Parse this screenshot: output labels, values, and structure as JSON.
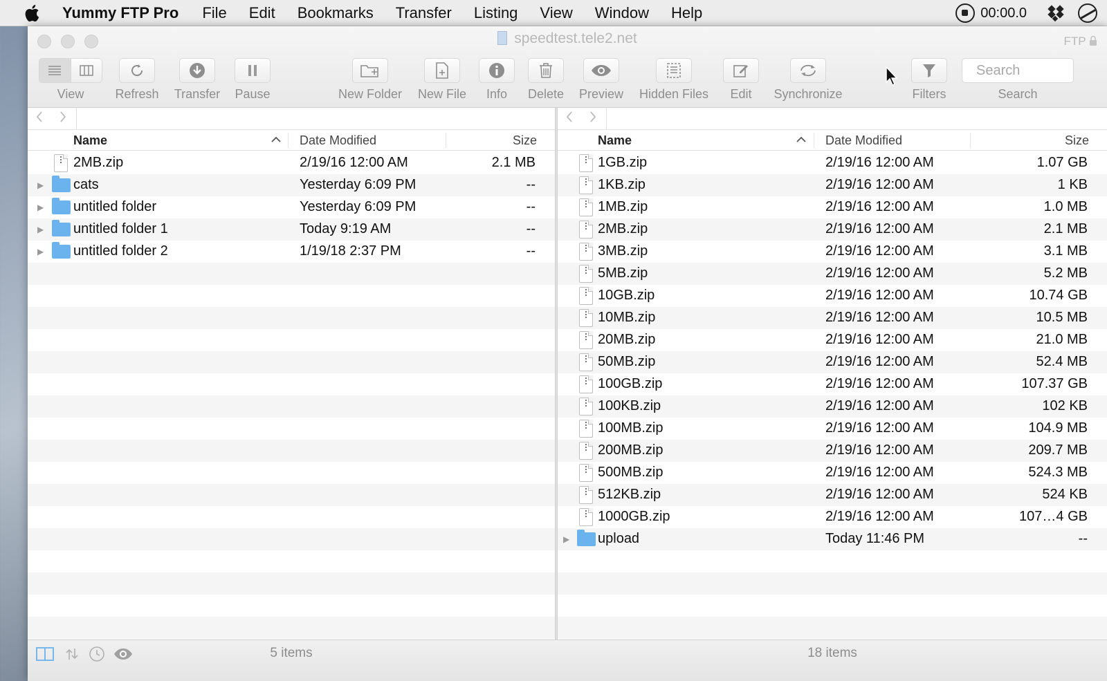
{
  "menubar": {
    "app_name": "Yummy FTP Pro",
    "items": [
      "File",
      "Edit",
      "Bookmarks",
      "Transfer",
      "Listing",
      "View",
      "Window",
      "Help"
    ],
    "recording_time": "00:00.0"
  },
  "window": {
    "title": "speedtest.tele2.net",
    "protocol": "FTP"
  },
  "toolbar": {
    "view": "View",
    "refresh": "Refresh",
    "transfer": "Transfer",
    "pause": "Pause",
    "new_folder": "New Folder",
    "new_file": "New File",
    "info": "Info",
    "delete": "Delete",
    "preview": "Preview",
    "hidden_files": "Hidden Files",
    "edit": "Edit",
    "synchronize": "Synchronize",
    "filters": "Filters",
    "search_placeholder": "Search",
    "search_label": "Search"
  },
  "columns": {
    "name": "Name",
    "date_modified": "Date Modified",
    "size": "Size"
  },
  "left_pane": {
    "status": "5 items",
    "rows": [
      {
        "type": "file",
        "name": "2MB.zip",
        "date": "2/19/16 12:00 AM",
        "size": "2.1 MB"
      },
      {
        "type": "folder",
        "name": "cats",
        "date": "Yesterday 6:09 PM",
        "size": "--"
      },
      {
        "type": "folder",
        "name": "untitled folder",
        "date": "Yesterday 6:09 PM",
        "size": "--"
      },
      {
        "type": "folder",
        "name": "untitled folder 1",
        "date": "Today 9:19 AM",
        "size": "--"
      },
      {
        "type": "folder",
        "name": "untitled folder 2",
        "date": "1/19/18 2:37 PM",
        "size": "--"
      }
    ]
  },
  "right_pane": {
    "status": "18 items",
    "rows": [
      {
        "type": "file",
        "name": "1GB.zip",
        "date": "2/19/16 12:00 AM",
        "size": "1.07 GB"
      },
      {
        "type": "file",
        "name": "1KB.zip",
        "date": "2/19/16 12:00 AM",
        "size": "1 KB"
      },
      {
        "type": "file",
        "name": "1MB.zip",
        "date": "2/19/16 12:00 AM",
        "size": "1.0 MB"
      },
      {
        "type": "file",
        "name": "2MB.zip",
        "date": "2/19/16 12:00 AM",
        "size": "2.1 MB"
      },
      {
        "type": "file",
        "name": "3MB.zip",
        "date": "2/19/16 12:00 AM",
        "size": "3.1 MB"
      },
      {
        "type": "file",
        "name": "5MB.zip",
        "date": "2/19/16 12:00 AM",
        "size": "5.2 MB"
      },
      {
        "type": "file",
        "name": "10GB.zip",
        "date": "2/19/16 12:00 AM",
        "size": "10.74 GB"
      },
      {
        "type": "file",
        "name": "10MB.zip",
        "date": "2/19/16 12:00 AM",
        "size": "10.5 MB"
      },
      {
        "type": "file",
        "name": "20MB.zip",
        "date": "2/19/16 12:00 AM",
        "size": "21.0 MB"
      },
      {
        "type": "file",
        "name": "50MB.zip",
        "date": "2/19/16 12:00 AM",
        "size": "52.4 MB"
      },
      {
        "type": "file",
        "name": "100GB.zip",
        "date": "2/19/16 12:00 AM",
        "size": "107.37 GB"
      },
      {
        "type": "file",
        "name": "100KB.zip",
        "date": "2/19/16 12:00 AM",
        "size": "102 KB"
      },
      {
        "type": "file",
        "name": "100MB.zip",
        "date": "2/19/16 12:00 AM",
        "size": "104.9 MB"
      },
      {
        "type": "file",
        "name": "200MB.zip",
        "date": "2/19/16 12:00 AM",
        "size": "209.7 MB"
      },
      {
        "type": "file",
        "name": "500MB.zip",
        "date": "2/19/16 12:00 AM",
        "size": "524.3 MB"
      },
      {
        "type": "file",
        "name": "512KB.zip",
        "date": "2/19/16 12:00 AM",
        "size": "524 KB"
      },
      {
        "type": "file",
        "name": "1000GB.zip",
        "date": "2/19/16 12:00 AM",
        "size": "107…4 GB"
      },
      {
        "type": "folder",
        "name": "upload",
        "date": "Today 11:46 PM",
        "size": "--"
      }
    ]
  },
  "colors": {
    "folder": "#6ab3ef",
    "toolbar_text": "#8e8e8e",
    "title_text": "#b8b8b8"
  }
}
